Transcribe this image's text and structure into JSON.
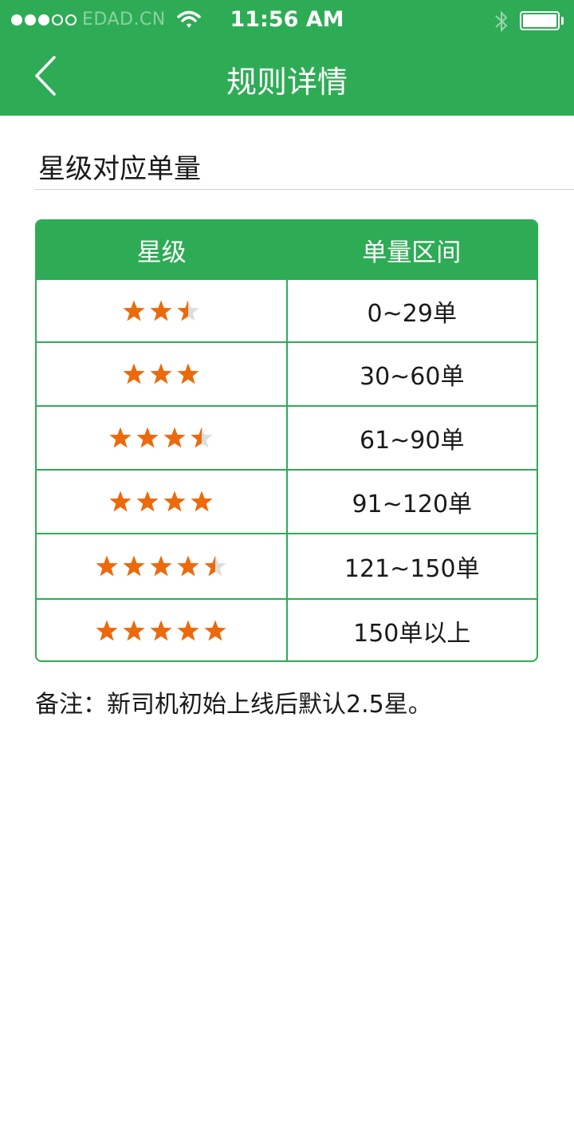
{
  "status_bar": {
    "carrier": "EDAD.CN",
    "time": "11:56 AM",
    "signal_dots": [
      true,
      true,
      true,
      false,
      false
    ],
    "icons": [
      "wifi-icon",
      "bluetooth-icon",
      "battery-icon"
    ]
  },
  "nav": {
    "title": "规则详情",
    "back_icon": "chevron-left-icon"
  },
  "section": {
    "title": "星级对应单量"
  },
  "table": {
    "headers": [
      "星级",
      "单量区间"
    ],
    "rows": [
      {
        "stars": 2.5,
        "range": "0~29单"
      },
      {
        "stars": 3,
        "range": "30~60单"
      },
      {
        "stars": 3.5,
        "range": "61~90单"
      },
      {
        "stars": 4,
        "range": "91~120单"
      },
      {
        "stars": 4.5,
        "range": "121~150单"
      },
      {
        "stars": 5,
        "range": "150单以上"
      }
    ]
  },
  "note": "备注：新司机初始上线后默认2.5星。",
  "colors": {
    "brand_green": "#2eac55",
    "star_orange": "#ec6a0c",
    "star_empty": "#dddddd"
  }
}
